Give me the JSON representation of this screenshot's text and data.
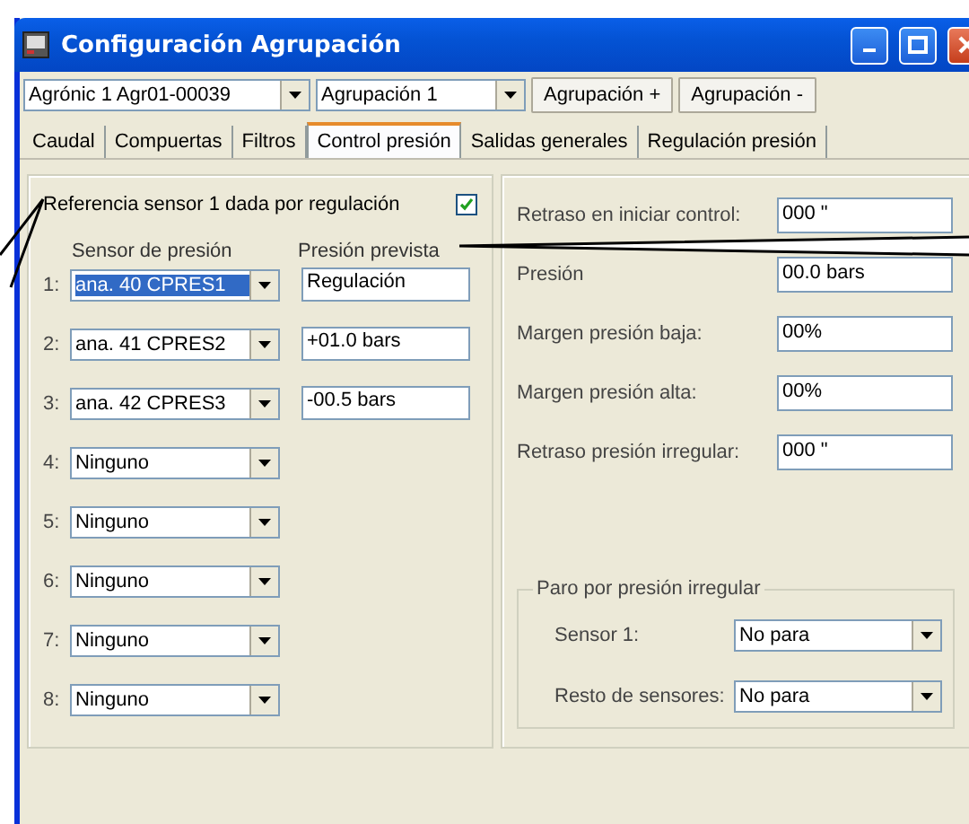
{
  "window": {
    "title": "Configuración Agrupación"
  },
  "toolbar": {
    "controller": "Agrónic 1 Agr01-00039",
    "group": "Agrupación 1",
    "buttons": [
      "Agrupación +",
      "Agrupación -"
    ]
  },
  "tabs": [
    {
      "label": "Caudal",
      "selected": false
    },
    {
      "label": "Compuertas",
      "selected": false
    },
    {
      "label": "Filtros",
      "selected": false
    },
    {
      "label": "Control presión",
      "selected": true
    },
    {
      "label": "Salidas generales",
      "selected": false
    },
    {
      "label": "Regulación presión",
      "selected": false
    }
  ],
  "reference": {
    "label": "Referencia sensor 1 dada por regulación",
    "checked": true
  },
  "headers": {
    "sensor": "Sensor de presión",
    "expected": "Presión prevista"
  },
  "sensors": [
    {
      "index": "1:",
      "sensor": "ana. 40 CPRES1",
      "focused": true,
      "expected": "Regulación"
    },
    {
      "index": "2:",
      "sensor": "ana. 41 CPRES2",
      "focused": false,
      "expected": "+01.0 bars"
    },
    {
      "index": "3:",
      "sensor": "ana. 42 CPRES3",
      "focused": false,
      "expected": "-00.5 bars"
    },
    {
      "index": "4:",
      "sensor": "Ninguno",
      "focused": false
    },
    {
      "index": "5:",
      "sensor": "Ninguno",
      "focused": false
    },
    {
      "index": "6:",
      "sensor": "Ninguno",
      "focused": false
    },
    {
      "index": "7:",
      "sensor": "Ninguno",
      "focused": false
    },
    {
      "index": "8:",
      "sensor": "Ninguno",
      "focused": false
    }
  ],
  "settings": [
    {
      "label": "Retraso en iniciar control:",
      "value": "000 \""
    },
    {
      "label": "Presión",
      "value": "00.0 bars"
    },
    {
      "label": "Margen presión baja:",
      "value": "00%"
    },
    {
      "label": "Margen presión alta:",
      "value": "00%"
    },
    {
      "label": "Retraso presión irregular:",
      "value": "000 \""
    }
  ],
  "stop_group": {
    "title": "Paro por presión irregular",
    "rows": [
      {
        "label": "Sensor 1:",
        "value": "No para"
      },
      {
        "label": "Resto de sensores:",
        "value": "No para"
      }
    ]
  }
}
